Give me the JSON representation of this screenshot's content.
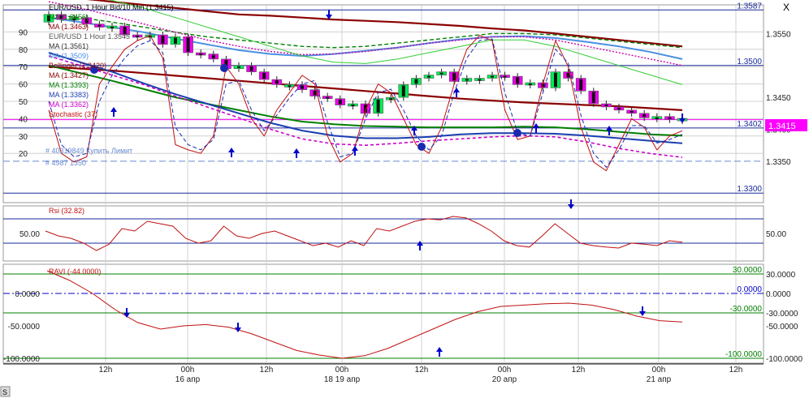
{
  "window": {
    "close_label": "X",
    "corner_label": "S"
  },
  "colors": {
    "background": "#ffffff",
    "grid": "#d0d0d0",
    "axis_line": "#1a1a1a",
    "level_line": "#1a2a9a",
    "bull_candle": "#00ee55",
    "bear_candle": "#ee00ee",
    "candle_outline": "#555555",
    "stochastic": "#c01010",
    "rsi": "#c01010",
    "ravi": "#c01010",
    "bollinger": "#8b0000",
    "price_box_bg": "#ff00ff",
    "arrow": "#0000cc",
    "ravi_upper": "#008000",
    "ravi_zero": "#0000cc",
    "limit_line": "#6a8ad0"
  },
  "time_axis": {
    "labels": [
      "12h",
      "00h",
      "12h",
      "00h",
      "12h",
      "00h",
      "12h",
      "00h",
      "12h"
    ],
    "date_labels": [
      "16 апр",
      "18 19 апр",
      "20 апр",
      "21 апр"
    ]
  },
  "chart_data": [
    {
      "type": "line",
      "title": "EUR/USD, 1 Hour Bid/10 Min (1.3415)",
      "legend": [
        {
          "name": "EUR/USD, 1 Hour Bid/10 Min (1.3415)",
          "color": "#000000"
        },
        {
          "name": "MA (1.3456)",
          "color": "#008000"
        },
        {
          "name": "MA (1.3463)",
          "color": "#8b0000"
        },
        {
          "name": "EUR/USD 1 Hour 1.3545",
          "color": "#555555"
        },
        {
          "name": "MA (1.3561)",
          "color": "#333333"
        },
        {
          "name": "MA (1.3509)",
          "color": "#4a90e2"
        },
        {
          "name": "Bollinger (1.3420)",
          "color": "#8b0000"
        },
        {
          "name": "MA (1.3427)",
          "color": "#8b0000"
        },
        {
          "name": "MA (1.3393)",
          "color": "#008000"
        },
        {
          "name": "MA (1.3383)",
          "color": "#1a3fb0"
        },
        {
          "name": "MA (1.3362)",
          "color": "#cc00cc"
        },
        {
          "name": "Stochastic (37)",
          "color": "#c01010"
        }
      ],
      "price_axis": {
        "ticks": [
          "1.3550",
          "1.3450",
          "1.3400",
          "1.3350"
        ],
        "range": [
          1.3285,
          1.3595
        ]
      },
      "stochastic_axis": {
        "ticks": [
          "90",
          "80",
          "70",
          "60",
          "50",
          "40",
          "30",
          "20"
        ],
        "range": [
          0,
          100
        ]
      },
      "levels": [
        {
          "label": "1.3587",
          "value": 1.3587
        },
        {
          "label": "1.3500",
          "value": 1.35
        },
        {
          "label": "1.3402",
          "value": 1.3402
        },
        {
          "label": "1.3300",
          "value": 1.33
        }
      ],
      "current_price": "1.3415",
      "orders": [
        "# 40319849 Купить Лимит",
        "# 4987 1350"
      ],
      "candles": {
        "x": [
          0,
          4,
          8,
          12,
          16,
          20,
          24,
          28,
          32,
          36,
          40,
          44,
          48,
          52,
          56,
          60,
          64,
          68,
          72,
          76,
          80,
          84,
          88,
          92,
          96,
          100,
          104,
          108,
          112,
          116,
          120,
          124,
          128,
          132,
          136,
          140,
          144,
          148,
          152,
          156,
          160,
          164,
          168,
          172,
          176,
          180,
          184,
          188,
          192,
          196,
          200
        ],
        "open": [
          1.3568,
          1.358,
          1.3572,
          1.3575,
          1.3565,
          1.356,
          1.3562,
          1.3548,
          1.3545,
          1.3548,
          1.3533,
          1.3545,
          1.352,
          1.3518,
          1.351,
          1.3495,
          1.35,
          1.349,
          1.3478,
          1.347,
          1.347,
          1.3462,
          1.3452,
          1.3448,
          1.3438,
          1.344,
          1.3425,
          1.3448,
          1.345,
          1.347,
          1.348,
          1.3485,
          1.349,
          1.3475,
          1.348,
          1.348,
          1.3485,
          1.3483,
          1.347,
          1.3473,
          1.3465,
          1.349,
          1.348,
          1.346,
          1.344,
          1.3435,
          1.343,
          1.3425,
          1.3418,
          1.342,
          1.3415
        ],
        "close": [
          1.358,
          1.3572,
          1.3575,
          1.3565,
          1.356,
          1.3562,
          1.3548,
          1.3545,
          1.3548,
          1.3533,
          1.3545,
          1.352,
          1.3518,
          1.351,
          1.3495,
          1.35,
          1.349,
          1.3478,
          1.347,
          1.347,
          1.3462,
          1.3452,
          1.3448,
          1.3438,
          1.344,
          1.3425,
          1.3448,
          1.345,
          1.347,
          1.348,
          1.3485,
          1.349,
          1.3475,
          1.348,
          1.348,
          1.3485,
          1.3483,
          1.347,
          1.3473,
          1.3465,
          1.349,
          1.348,
          1.346,
          1.344,
          1.3435,
          1.343,
          1.3425,
          1.3418,
          1.342,
          1.3415,
          1.3417
        ]
      },
      "series": [
        {
          "name": "Stochastic",
          "color": "#c01010",
          "values": [
            45,
            20,
            15,
            18,
            60,
            70,
            80,
            85,
            88,
            75,
            25,
            22,
            20,
            30,
            70,
            60,
            40,
            30,
            45,
            55,
            65,
            60,
            30,
            15,
            20,
            45,
            60,
            55,
            40,
            25,
            20,
            35,
            60,
            80,
            88,
            85,
            45,
            28,
            30,
            60,
            85,
            70,
            35,
            15,
            10,
            25,
            40,
            35,
            22,
            30,
            33
          ]
        },
        {
          "name": "Stochastic signal",
          "color": "#1a2ab0",
          "values": [
            50,
            25,
            18,
            20,
            50,
            65,
            75,
            82,
            85,
            78,
            35,
            25,
            22,
            28,
            60,
            62,
            45,
            33,
            42,
            52,
            60,
            62,
            38,
            18,
            20,
            40,
            55,
            57,
            45,
            30,
            22,
            30,
            55,
            75,
            85,
            86,
            55,
            32,
            30,
            55,
            80,
            72,
            42,
            20,
            12,
            22,
            36,
            36,
            26,
            28,
            31
          ]
        },
        {
          "name": "Bollinger mid",
          "color": "#8b0000",
          "values": [
            1.3498,
            1.3495,
            1.3492,
            1.3488,
            1.3484,
            1.348,
            1.3476,
            1.3472,
            1.3468,
            1.3464,
            1.346,
            1.3456,
            1.3452,
            1.3448,
            1.3445,
            1.3442,
            1.344,
            1.3438,
            1.3436,
            1.3433,
            1.343
          ]
        },
        {
          "name": "MA green",
          "color": "#008000",
          "values": [
            1.35,
            1.3488,
            1.3476,
            1.3463,
            1.345,
            1.344,
            1.343,
            1.342,
            1.3412,
            1.3408,
            1.3405,
            1.3404,
            1.3403,
            1.3403,
            1.3403,
            1.3404,
            1.3403,
            1.34,
            1.3396,
            1.3392,
            1.339
          ]
        },
        {
          "name": "MA blue",
          "color": "#1a3fb0",
          "values": [
            1.352,
            1.3505,
            1.349,
            1.3472,
            1.3455,
            1.344,
            1.3425,
            1.341,
            1.3398,
            1.339,
            1.3386,
            1.3386,
            1.3388,
            1.3392,
            1.3394,
            1.3394,
            1.3393,
            1.339,
            1.3386,
            1.3382,
            1.3378
          ]
        },
        {
          "name": "MA magenta",
          "color": "#cc00cc",
          "values": [
            1.3515,
            1.35,
            1.3485,
            1.347,
            1.3452,
            1.3435,
            1.3418,
            1.34,
            1.3385,
            1.3377,
            1.3375,
            1.3378,
            1.3382,
            1.3385,
            1.3388,
            1.339,
            1.3388,
            1.338,
            1.337,
            1.3362,
            1.3356
          ]
        },
        {
          "name": "MA dark red (upper)",
          "color": "#8b0000",
          "values": [
            1.361,
            1.3605,
            1.36,
            1.3595,
            1.359,
            1.3585,
            1.358,
            1.3578,
            1.3575,
            1.3572,
            1.357,
            1.3568,
            1.3565,
            1.3562,
            1.3558,
            1.3555,
            1.355,
            1.3545,
            1.354,
            1.3535,
            1.353
          ]
        },
        {
          "name": "MA green dashed",
          "color": "#008000",
          "values": [
            1.358,
            1.3575,
            1.3568,
            1.356,
            1.3552,
            1.3545,
            1.354,
            1.3535,
            1.353,
            1.3528,
            1.353,
            1.3535,
            1.354,
            1.3545,
            1.355,
            1.355,
            1.3548,
            1.3543,
            1.3538,
            1.3533,
            1.3528
          ]
        },
        {
          "name": "MA light blue",
          "color": "#4a90e2",
          "values": [
            1.3575,
            1.3568,
            1.356,
            1.3552,
            1.3542,
            1.3533,
            1.3524,
            1.3518,
            1.3515,
            1.3518,
            1.3523,
            1.3528,
            1.3535,
            1.3541,
            1.3545,
            1.3546,
            1.3543,
            1.3537,
            1.353,
            1.3521,
            1.351
          ]
        },
        {
          "name": "MA pink dotted",
          "color": "#cc00aa",
          "values": [
            1.36,
            1.359,
            1.3578,
            1.3565,
            1.3552,
            1.354,
            1.353,
            1.3522,
            1.3517,
            1.3518,
            1.3522,
            1.3528,
            1.3535,
            1.354,
            1.3545,
            1.3545,
            1.354,
            1.353,
            1.352,
            1.351,
            1.35
          ]
        },
        {
          "name": "Green light upper",
          "color": "#33cc33",
          "values": [
            1.362,
            1.3612,
            1.3602,
            1.359,
            1.3575,
            1.356,
            1.3545,
            1.353,
            1.3515,
            1.3505,
            1.3503,
            1.351,
            1.352,
            1.353,
            1.354,
            1.354,
            1.353,
            1.3515,
            1.35,
            1.3485,
            1.347
          ]
        }
      ]
    },
    {
      "type": "line",
      "title": "Rsi (32.82)",
      "axis": {
        "ticks": [
          "50.00"
        ],
        "range": [
          0,
          100
        ]
      },
      "series": [
        {
          "name": "Rsi",
          "color": "#c01010",
          "values": [
            55,
            45,
            40,
            30,
            15,
            28,
            60,
            55,
            75,
            70,
            65,
            40,
            30,
            35,
            65,
            45,
            40,
            50,
            55,
            45,
            35,
            25,
            30,
            22,
            35,
            25,
            60,
            55,
            65,
            75,
            80,
            78,
            85,
            82,
            70,
            55,
            35,
            25,
            22,
            45,
            70,
            50,
            30,
            25,
            22,
            20,
            30,
            28,
            25,
            35,
            32
          ]
        }
      ],
      "levels": [
        80,
        30
      ]
    },
    {
      "type": "line",
      "title": "RAVI (-44.0000)",
      "axis": {
        "ticks": [
          "30.0000",
          "0.0000",
          "-30.0000",
          "-50.0000",
          "-100.0000"
        ],
        "range": [
          -105,
          40
        ]
      },
      "series": [
        {
          "name": "RAVI",
          "color": "#c01010",
          "values": [
            35,
            20,
            0,
            -25,
            -45,
            -55,
            -50,
            -48,
            -52,
            -62,
            -75,
            -88,
            -95,
            -100,
            -96,
            -85,
            -70,
            -55,
            -40,
            -28,
            -20,
            -18,
            -16,
            -15,
            -18,
            -25,
            -35,
            -42,
            -44
          ]
        }
      ],
      "levels": [
        30,
        0,
        -30,
        -100
      ]
    }
  ]
}
